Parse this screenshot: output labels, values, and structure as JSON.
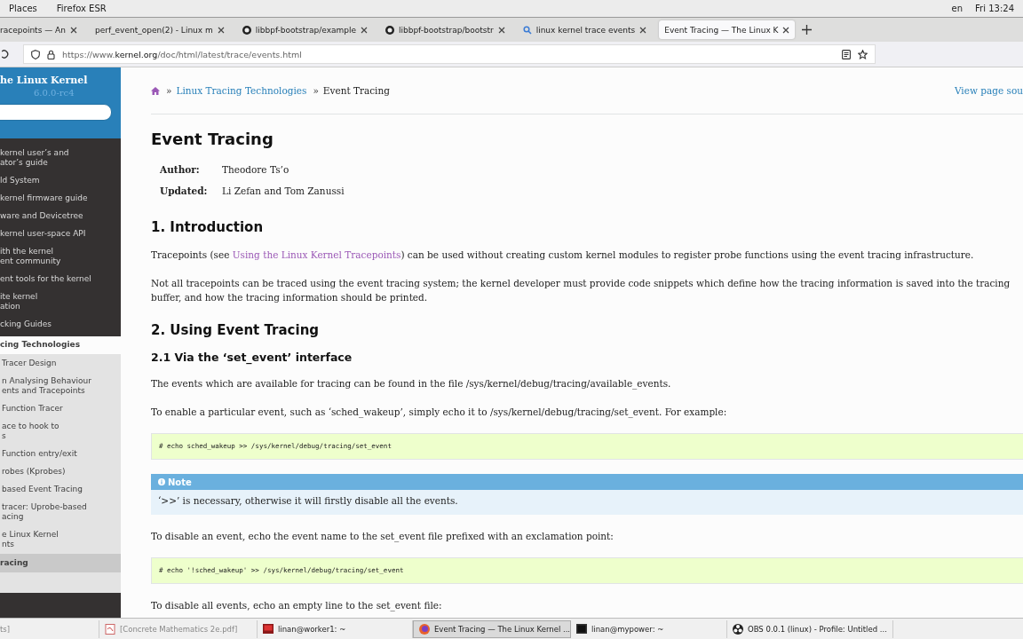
{
  "top_bar": {
    "menus": [
      "Places",
      "Firefox ESR"
    ],
    "keyboard": "en",
    "clock": "Fri 13:24"
  },
  "tabs": [
    {
      "label": "racepoints — An",
      "kind": "page",
      "selected": false
    },
    {
      "label": "perf_event_open(2) - Linux m",
      "kind": "page",
      "selected": false
    },
    {
      "label": "libbpf-bootstrap/example",
      "kind": "repository",
      "selected": false
    },
    {
      "label": "libbpf-bootstrap/bootstr",
      "kind": "repository",
      "selected": false
    },
    {
      "label": "linux kernel trace events",
      "kind": "search",
      "selected": false
    },
    {
      "label": "Event Tracing — The Linux K",
      "kind": "page",
      "selected": true
    }
  ],
  "address_bar": {
    "prefix": "https://www.",
    "domain": "kernel.org",
    "path": "/doc/html/latest/trace/events.html"
  },
  "sidebar": {
    "title": "he Linux Kernel",
    "version": "6.0.0-rc4",
    "items": [
      {
        "lines": [
          "kernel user’s and",
          "ator’s guide"
        ],
        "kind": "dark",
        "selected": false
      },
      {
        "lines": [
          "ld System"
        ],
        "kind": "dark",
        "selected": false
      },
      {
        "lines": [
          "kernel firmware guide"
        ],
        "kind": "dark",
        "selected": false
      },
      {
        "lines": [
          "ware and Devicetree"
        ],
        "kind": "dark",
        "selected": false
      },
      {
        "lines": [
          "kernel user-space API"
        ],
        "kind": "dark",
        "selected": false
      },
      {
        "lines": [
          "ith the kernel",
          "ent community"
        ],
        "kind": "dark",
        "selected": false
      },
      {
        "lines": [
          "ent tools for the kernel"
        ],
        "kind": "dark",
        "selected": false
      },
      {
        "lines": [
          "ite kernel",
          "ation"
        ],
        "kind": "dark",
        "selected": false
      },
      {
        "lines": [
          "cking Guides"
        ],
        "kind": "dark",
        "selected": false
      },
      {
        "lines": [
          "cing Technologies"
        ],
        "kind": "current",
        "selected": true
      },
      {
        "lines": [
          "Tracer Design"
        ],
        "kind": "sub",
        "selected": false
      },
      {
        "lines": [
          "n Analysing Behaviour",
          "ents and Tracepoints"
        ],
        "kind": "sub",
        "selected": false
      },
      {
        "lines": [
          "Function Tracer"
        ],
        "kind": "sub",
        "selected": false
      },
      {
        "lines": [
          "ace to hook to",
          "s"
        ],
        "kind": "sub",
        "selected": false
      },
      {
        "lines": [
          "Function entry/exit"
        ],
        "kind": "sub",
        "selected": false
      },
      {
        "lines": [
          "robes (Kprobes)"
        ],
        "kind": "sub",
        "selected": false
      },
      {
        "lines": [
          "based Event Tracing"
        ],
        "kind": "sub",
        "selected": false
      },
      {
        "lines": [
          "tracer: Uprobe-based",
          "acing"
        ],
        "kind": "sub",
        "selected": false
      },
      {
        "lines": [
          "e Linux Kernel",
          "nts"
        ],
        "kind": "sub",
        "selected": false
      },
      {
        "lines": [
          "racing"
        ],
        "kind": "sub",
        "selected": true
      }
    ]
  },
  "breadcrumb": {
    "items": [
      "Linux Tracing Technologies",
      "Event Tracing"
    ],
    "separator": "»",
    "source_link": "View page sou"
  },
  "content": [
    {
      "kind": "h1",
      "text": "Event Tracing"
    },
    {
      "kind": "field",
      "label": "Author:",
      "value": "Theodore Ts’o"
    },
    {
      "kind": "field",
      "label": "Updated:",
      "value": "Li Zefan and Tom Zanussi"
    },
    {
      "kind": "h2",
      "text": "1. Introduction"
    },
    {
      "kind": "para",
      "before": "Tracepoints (see ",
      "link": "Using the Linux Kernel Tracepoints",
      "after": ") can be used without creating custom kernel modules to register probe functions using the event tracing infrastructure."
    },
    {
      "kind": "para",
      "lines": [
        "Not all tracepoints can be traced using the event tracing system; the kernel developer must provide code snippets which define how the tracing information is saved into the tracing",
        "buffer, and how the tracing information should be printed."
      ]
    },
    {
      "kind": "h2",
      "text": "2. Using Event Tracing"
    },
    {
      "kind": "h3",
      "text": "2.1 Via the ‘set_event’ interface"
    },
    {
      "kind": "para",
      "text": "The events which are available for tracing can be found in the file /sys/kernel/debug/tracing/available_events."
    },
    {
      "kind": "para",
      "text": "To enable a particular event, such as ‘sched_wakeup’, simply echo it to /sys/kernel/debug/tracing/set_event. For example:"
    },
    {
      "kind": "code",
      "text": "# echo sched_wakeup >> /sys/kernel/debug/tracing/set_event"
    },
    {
      "kind": "note",
      "title": "Note",
      "text": "‘>>’ is necessary, otherwise it will firstly disable all the events."
    },
    {
      "kind": "para",
      "text": "To disable an event, echo the event name to the set_event file prefixed with an exclamation point:"
    },
    {
      "kind": "code",
      "text": "# echo '!sched_wakeup' >> /sys/kernel/debug/tracing/set_event"
    },
    {
      "kind": "para",
      "text": "To disable all events, echo an empty line to the set_event file:"
    }
  ],
  "taskbar": [
    {
      "label": "ts]",
      "kind": "window",
      "minimized": true,
      "selected": false
    },
    {
      "label": "[Concrete Mathematics 2e.pdf]",
      "kind": "document",
      "minimized": true,
      "selected": false
    },
    {
      "label": "linan@worker1: ~",
      "kind": "console",
      "minimized": false,
      "selected": false
    },
    {
      "label": "Event Tracing — The Linux Kernel ...",
      "kind": "browser",
      "minimized": false,
      "selected": true
    },
    {
      "label": "linan@mypower: ~",
      "kind": "terminal",
      "minimized": false,
      "selected": false
    },
    {
      "label": "OBS 0.0.1 (linux) - Profile: Untitled ...",
      "kind": "recorder",
      "minimized": false,
      "selected": false
    }
  ]
}
